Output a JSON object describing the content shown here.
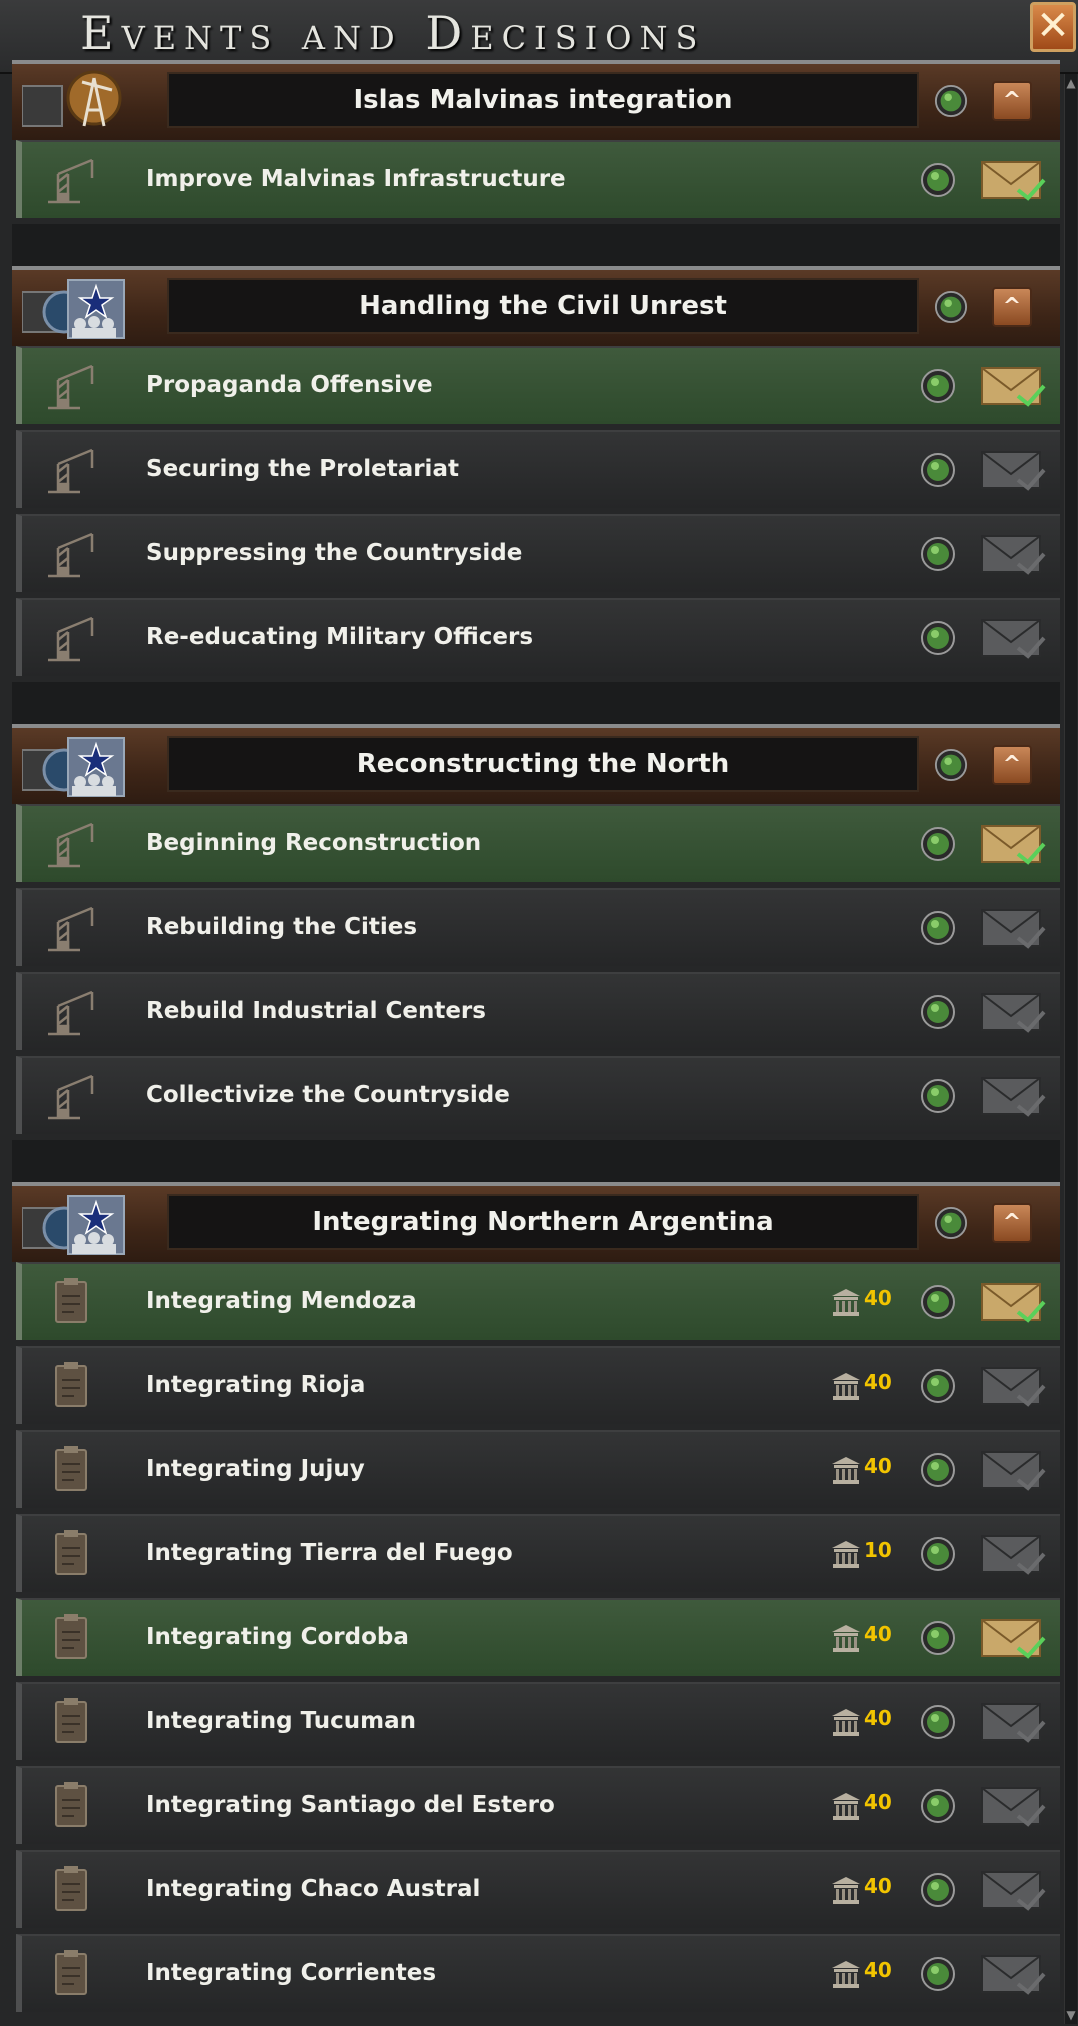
{
  "window": {
    "title": "Events and Decisions",
    "close_label": "✕"
  },
  "colors": {
    "available_row": "#3f5a3c",
    "cost_text": "#f2c400",
    "header_brown": "#5a3a26"
  },
  "categories": [
    {
      "title": "Islas Malvinas integration",
      "icon": "oil-derrick-icon",
      "decisions": [
        {
          "label": "Improve Malvinas Infrastructure",
          "status": "available",
          "icon": "crane-icon",
          "cost": ""
        }
      ]
    },
    {
      "title": "Handling the Civil Unrest",
      "icon": "communist-star-crowd-icon",
      "decisions": [
        {
          "label": "Propaganda Offensive",
          "status": "available",
          "icon": "crane-icon",
          "cost": ""
        },
        {
          "label": "Securing the Proletariat",
          "status": "locked",
          "icon": "crane-icon",
          "cost": ""
        },
        {
          "label": "Suppressing the Countryside",
          "status": "locked",
          "icon": "crane-icon",
          "cost": ""
        },
        {
          "label": "Re-educating Military Officers",
          "status": "locked",
          "icon": "crane-icon",
          "cost": ""
        }
      ]
    },
    {
      "title": "Reconstructing the North",
      "icon": "communist-star-crowd-icon",
      "decisions": [
        {
          "label": "Beginning Reconstruction",
          "status": "available",
          "icon": "crane-icon",
          "cost": ""
        },
        {
          "label": "Rebuilding the Cities",
          "status": "locked",
          "icon": "crane-icon",
          "cost": ""
        },
        {
          "label": "Rebuild Industrial Centers",
          "status": "locked",
          "icon": "crane-icon",
          "cost": ""
        },
        {
          "label": "Collectivize the Countryside",
          "status": "locked",
          "icon": "crane-icon",
          "cost": ""
        }
      ]
    },
    {
      "title": "Integrating Northern Argentina",
      "icon": "communist-star-crowd-icon",
      "decisions": [
        {
          "label": "Integrating Mendoza",
          "status": "available",
          "icon": "document-icon",
          "cost": "40"
        },
        {
          "label": "Integrating Rioja",
          "status": "locked",
          "icon": "document-icon",
          "cost": "40"
        },
        {
          "label": "Integrating Jujuy",
          "status": "locked",
          "icon": "document-icon",
          "cost": "40"
        },
        {
          "label": "Integrating Tierra del Fuego",
          "status": "locked",
          "icon": "document-icon",
          "cost": "10"
        },
        {
          "label": "Integrating Cordoba",
          "status": "available",
          "icon": "document-icon",
          "cost": "40"
        },
        {
          "label": "Integrating Tucuman",
          "status": "locked",
          "icon": "document-icon",
          "cost": "40"
        },
        {
          "label": "Integrating Santiago del Estero",
          "status": "locked",
          "icon": "document-icon",
          "cost": "40"
        },
        {
          "label": "Integrating Chaco Austral",
          "status": "locked",
          "icon": "document-icon",
          "cost": "40"
        },
        {
          "label": "Integrating Corrientes",
          "status": "locked",
          "icon": "document-icon",
          "cost": "40"
        }
      ]
    }
  ]
}
